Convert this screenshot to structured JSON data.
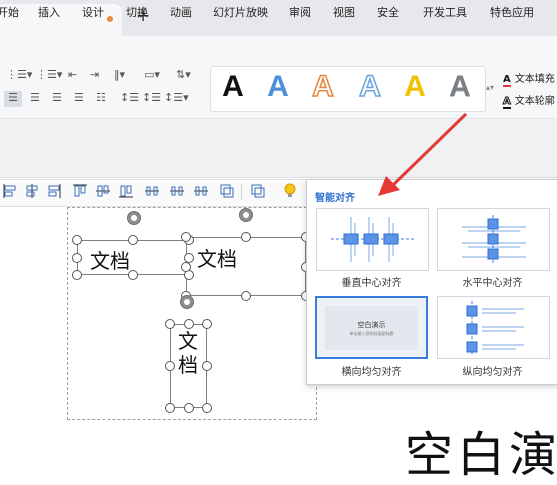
{
  "tabs": {
    "add_label": "+"
  },
  "menu": [
    "开始",
    "插入",
    "设计",
    "切换",
    "动画",
    "幻灯片放映",
    "审阅",
    "视图",
    "安全",
    "开发工具",
    "特色应用"
  ],
  "ribbon": {
    "art_gallery": [
      {
        "letter": "A",
        "color": "#111111",
        "style": "solid"
      },
      {
        "letter": "A",
        "color": "#4a90d9",
        "style": "solid"
      },
      {
        "letter": "A",
        "color": "#e8843a",
        "style": "outline"
      },
      {
        "letter": "A",
        "color": "#6aa4de",
        "style": "outline"
      },
      {
        "letter": "A",
        "color": "#f2c200",
        "style": "solid"
      },
      {
        "letter": "A",
        "color": "#7b7f86",
        "style": "gradient"
      }
    ],
    "text_fill_label": "文本填充",
    "text_outline_label": "文本轮廓"
  },
  "slide": {
    "box1_text": "文档",
    "box2_text": "文档",
    "box3_text": "文\n档",
    "title_text": "空白演"
  },
  "smart_align": {
    "title": "智能对齐",
    "options": [
      {
        "label": "垂直中心对齐",
        "selected": false
      },
      {
        "label": "水平中心对齐",
        "selected": false
      },
      {
        "label": "横向均匀对齐",
        "selected": true,
        "thumb_title": "空白演示",
        "thumb_sub": "单击输入您的封面副标题"
      },
      {
        "label": "纵向均匀对齐",
        "selected": false
      }
    ]
  },
  "colors": {
    "accent": "#3a7be0",
    "arrow": "#e53935",
    "tab_dot": "#f0883a"
  }
}
